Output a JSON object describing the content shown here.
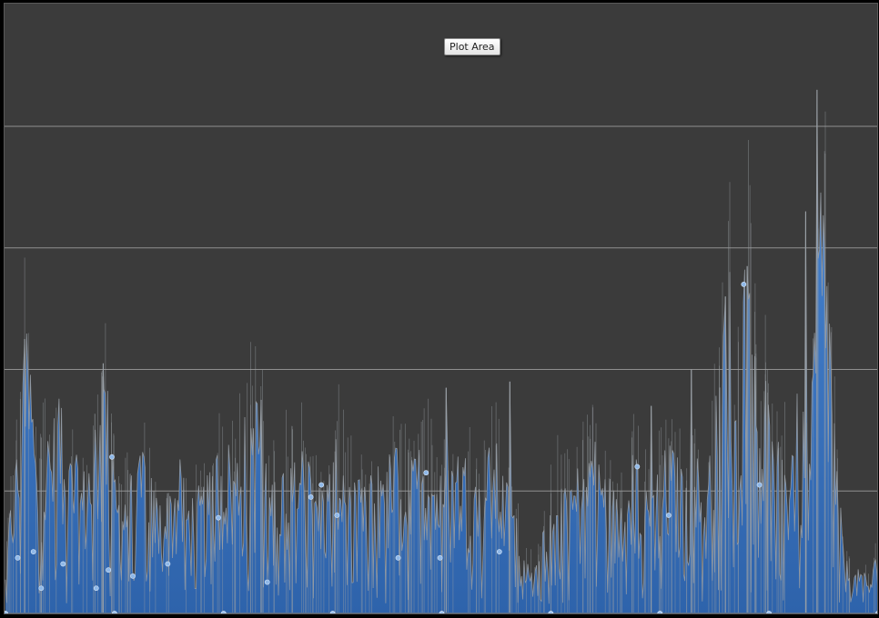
{
  "tooltip": {
    "label": "Plot Area"
  },
  "chart_data": {
    "type": "area",
    "title": "",
    "xlabel": "",
    "ylabel": "",
    "ylim": [
      0,
      5
    ],
    "grid": true,
    "gridlines_y": [
      1,
      2,
      3,
      4
    ],
    "axis_labels_visible": false,
    "legend": "none",
    "colors": {
      "background": "#3b3b3b",
      "fill": "#3a76c4",
      "fill_dark": "#1f4f8f",
      "stroke": "#9aa0a6",
      "grid": "#8f8f8f",
      "marker": "#8fb8e8"
    },
    "envelope_points": [
      [
        0.0,
        0.3
      ],
      [
        0.008,
        1.05
      ],
      [
        0.017,
        1.4
      ],
      [
        0.022,
        2.2
      ],
      [
        0.03,
        1.9
      ],
      [
        0.036,
        1.1
      ],
      [
        0.045,
        1.35
      ],
      [
        0.055,
        1.45
      ],
      [
        0.062,
        1.8
      ],
      [
        0.068,
        1.1
      ],
      [
        0.078,
        1.25
      ],
      [
        0.088,
        1.05
      ],
      [
        0.098,
        1.3
      ],
      [
        0.108,
        1.75
      ],
      [
        0.115,
        1.95
      ],
      [
        0.122,
        1.2
      ],
      [
        0.132,
        0.9
      ],
      [
        0.142,
        1.1
      ],
      [
        0.15,
        1.05
      ],
      [
        0.16,
        1.35
      ],
      [
        0.17,
        0.95
      ],
      [
        0.18,
        0.85
      ],
      [
        0.19,
        1.0
      ],
      [
        0.2,
        1.15
      ],
      [
        0.21,
        0.9
      ],
      [
        0.22,
        0.95
      ],
      [
        0.23,
        1.0
      ],
      [
        0.242,
        1.25
      ],
      [
        0.252,
        1.4
      ],
      [
        0.262,
        1.15
      ],
      [
        0.272,
        1.45
      ],
      [
        0.282,
        1.7
      ],
      [
        0.292,
        1.65
      ],
      [
        0.302,
        1.0
      ],
      [
        0.312,
        1.1
      ],
      [
        0.322,
        1.25
      ],
      [
        0.332,
        1.15
      ],
      [
        0.342,
        1.35
      ],
      [
        0.352,
        1.05
      ],
      [
        0.362,
        1.0
      ],
      [
        0.372,
        1.1
      ],
      [
        0.382,
        1.4
      ],
      [
        0.392,
        1.15
      ],
      [
        0.402,
        1.05
      ],
      [
        0.412,
        0.95
      ],
      [
        0.422,
        1.15
      ],
      [
        0.432,
        1.3
      ],
      [
        0.442,
        1.2
      ],
      [
        0.452,
        1.35
      ],
      [
        0.462,
        1.1
      ],
      [
        0.472,
        1.25
      ],
      [
        0.482,
        1.4
      ],
      [
        0.492,
        1.15
      ],
      [
        0.502,
        1.05
      ],
      [
        0.512,
        1.2
      ],
      [
        0.522,
        1.3
      ],
      [
        0.532,
        1.15
      ],
      [
        0.542,
        1.05
      ],
      [
        0.552,
        1.25
      ],
      [
        0.562,
        1.3
      ],
      [
        0.572,
        1.05
      ],
      [
        0.582,
        0.85
      ],
      [
        0.59,
        0.7
      ],
      [
        0.598,
        0.5
      ],
      [
        0.606,
        0.3
      ],
      [
        0.614,
        0.55
      ],
      [
        0.622,
        0.9
      ],
      [
        0.632,
        1.1
      ],
      [
        0.642,
        1.2
      ],
      [
        0.652,
        1.05
      ],
      [
        0.662,
        1.25
      ],
      [
        0.672,
        1.4
      ],
      [
        0.682,
        1.2
      ],
      [
        0.692,
        1.05
      ],
      [
        0.702,
        0.85
      ],
      [
        0.712,
        1.1
      ],
      [
        0.722,
        1.25
      ],
      [
        0.732,
        1.05
      ],
      [
        0.742,
        1.0
      ],
      [
        0.752,
        1.2
      ],
      [
        0.762,
        1.3
      ],
      [
        0.772,
        1.15
      ],
      [
        0.782,
        1.05
      ],
      [
        0.792,
        1.2
      ],
      [
        0.802,
        1.0
      ],
      [
        0.81,
        1.35
      ],
      [
        0.818,
        1.9
      ],
      [
        0.824,
        2.55
      ],
      [
        0.83,
        2.65
      ],
      [
        0.836,
        1.5
      ],
      [
        0.842,
        2.1
      ],
      [
        0.848,
        2.8
      ],
      [
        0.854,
        2.95
      ],
      [
        0.86,
        2.1
      ],
      [
        0.866,
        1.6
      ],
      [
        0.872,
        1.9
      ],
      [
        0.88,
        1.2
      ],
      [
        0.89,
        1.35
      ],
      [
        0.9,
        1.4
      ],
      [
        0.908,
        1.7
      ],
      [
        0.916,
        1.5
      ],
      [
        0.922,
        1.3
      ],
      [
        0.928,
        2.4
      ],
      [
        0.934,
        3.4
      ],
      [
        0.94,
        3.1
      ],
      [
        0.946,
        2.2
      ],
      [
        0.952,
        1.3
      ],
      [
        0.958,
        0.7
      ],
      [
        0.964,
        0.4
      ],
      [
        0.972,
        0.3
      ],
      [
        0.982,
        0.35
      ],
      [
        0.992,
        0.25
      ],
      [
        1.0,
        0.55
      ]
    ],
    "highlight_peaks": [
      [
        0.93,
        4.3
      ],
      [
        0.917,
        3.3
      ],
      [
        0.85,
        2.85
      ],
      [
        0.825,
        2.6
      ],
      [
        0.112,
        2.05
      ],
      [
        0.022,
        2.25
      ],
      [
        0.293,
        1.75
      ],
      [
        0.505,
        1.85
      ],
      [
        0.578,
        1.9
      ],
      [
        0.74,
        1.7
      ],
      [
        0.786,
        2.0
      ]
    ],
    "markers": [
      [
        0.122,
        1.28
      ],
      [
        0.244,
        0.78
      ],
      [
        0.362,
        1.05
      ],
      [
        0.482,
        1.15
      ],
      [
        0.724,
        1.2
      ],
      [
        0.846,
        2.7
      ],
      [
        0.014,
        0.45
      ],
      [
        0.032,
        0.5
      ],
      [
        0.041,
        0.2
      ],
      [
        0.066,
        0.4
      ],
      [
        0.104,
        0.2
      ],
      [
        0.118,
        0.35
      ],
      [
        0.146,
        0.3
      ],
      [
        0.186,
        0.4
      ],
      [
        0.3,
        0.25
      ],
      [
        0.35,
        0.95
      ],
      [
        0.38,
        0.8
      ],
      [
        0.45,
        0.45
      ],
      [
        0.498,
        0.45
      ],
      [
        0.566,
        0.5
      ],
      [
        0.76,
        0.8
      ],
      [
        0.864,
        1.05
      ]
    ],
    "xaxis_ticks": [
      0,
      0.125,
      0.25,
      0.375,
      0.5,
      0.625,
      0.75,
      0.875,
      1.0
    ]
  }
}
